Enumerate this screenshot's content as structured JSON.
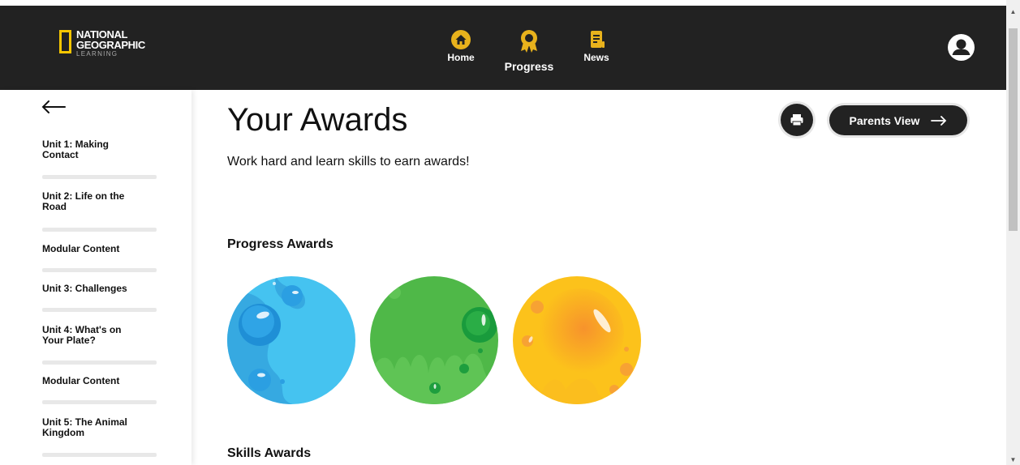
{
  "brand": {
    "name_line1": "NATIONAL",
    "name_line2": "GEOGRAPHIC",
    "sub": "LEARNING",
    "accent_color": "#f7c600"
  },
  "topnav": {
    "items": [
      {
        "label": "Home",
        "icon": "home-icon"
      },
      {
        "label": "Progress",
        "icon": "ribbon-award-icon",
        "active": true
      },
      {
        "label": "News",
        "icon": "news-icon"
      }
    ],
    "user_icon": "user-avatar-icon"
  },
  "sidebar": {
    "back_icon": "back-arrow-icon",
    "items": [
      {
        "label": "Unit 1: Making Contact"
      },
      {
        "label": "Unit 2: Life on the Road"
      },
      {
        "label": "Modular Content"
      },
      {
        "label": "Unit 3: Challenges"
      },
      {
        "label": "Unit 4: What's on Your Plate?"
      },
      {
        "label": "Modular Content"
      },
      {
        "label": "Unit 5: The Animal Kingdom"
      }
    ]
  },
  "main": {
    "title": "Your Awards",
    "subtitle": "Work hard and learn skills to earn awards!",
    "print_icon": "print-icon",
    "parents_view_label": "Parents View",
    "sections": [
      {
        "heading": "Progress Awards"
      },
      {
        "heading": "Skills Awards"
      }
    ],
    "progress_awards": [
      {
        "color": "blue",
        "base": "#45c3f0"
      },
      {
        "color": "green",
        "base": "#4fb848"
      },
      {
        "color": "yellow",
        "base": "#fcc21b"
      }
    ]
  }
}
